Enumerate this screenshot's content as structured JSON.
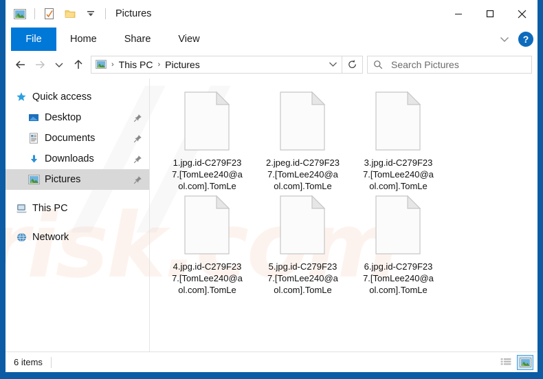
{
  "window": {
    "title": "Pictures",
    "quick_access_toolbar": [
      {
        "name": "pictures-library-icon",
        "label": "Pictures library"
      },
      {
        "name": "properties-icon",
        "label": "Properties"
      },
      {
        "name": "new-folder-icon",
        "label": "New folder"
      },
      {
        "name": "customize-quick-access-icon",
        "label": "Customize Quick Access Toolbar"
      }
    ],
    "caption_buttons": [
      {
        "name": "minimize-button",
        "label": "Minimize",
        "glyph": "—"
      },
      {
        "name": "maximize-button",
        "label": "Maximize",
        "glyph": "□"
      },
      {
        "name": "close-button",
        "label": "Close",
        "glyph": "✕"
      }
    ]
  },
  "ribbon": {
    "tabs": [
      {
        "label": "File",
        "active": true
      },
      {
        "label": "Home",
        "active": false
      },
      {
        "label": "Share",
        "active": false
      },
      {
        "label": "View",
        "active": false
      }
    ],
    "expand_label": "Expand the Ribbon",
    "help_label": "?"
  },
  "address": {
    "back_label": "Back",
    "forward_label": "Forward",
    "recent_label": "Recent locations",
    "up_label": "Up",
    "breadcrumb": [
      "This PC",
      "Pictures"
    ],
    "separator": "›",
    "dropdown_label": "Previous locations",
    "refresh_label": "Refresh"
  },
  "search": {
    "placeholder": "Search Pictures",
    "value": ""
  },
  "sidebar": {
    "items": [
      {
        "label": "Quick access",
        "icon": "star-icon",
        "level": "root",
        "pinned": false,
        "selected": false
      },
      {
        "label": "Desktop",
        "icon": "desktop-icon",
        "level": "child",
        "pinned": true,
        "selected": false
      },
      {
        "label": "Documents",
        "icon": "documents-icon",
        "level": "child",
        "pinned": true,
        "selected": false
      },
      {
        "label": "Downloads",
        "icon": "downloads-icon",
        "level": "child",
        "pinned": true,
        "selected": false
      },
      {
        "label": "Pictures",
        "icon": "pictures-icon",
        "level": "child",
        "pinned": true,
        "selected": true
      },
      {
        "label": "This PC",
        "icon": "this-pc-icon",
        "level": "root",
        "pinned": false,
        "selected": false
      },
      {
        "label": "Network",
        "icon": "network-icon",
        "level": "root",
        "pinned": false,
        "selected": false
      }
    ]
  },
  "files": [
    {
      "name": "1.jpg.id-C279F237.[TomLee240@aol.com].TomLe",
      "icon": "blank-file-icon"
    },
    {
      "name": "2.jpeg.id-C279F237.[TomLee240@aol.com].TomLe",
      "icon": "blank-file-icon"
    },
    {
      "name": "3.jpg.id-C279F237.[TomLee240@aol.com].TomLe",
      "icon": "blank-file-icon"
    },
    {
      "name": "4.jpg.id-C279F237.[TomLee240@aol.com].TomLe",
      "icon": "blank-file-icon"
    },
    {
      "name": "5.jpg.id-C279F237.[TomLee240@aol.com].TomLe",
      "icon": "blank-file-icon"
    },
    {
      "name": "6.jpg.id-C279F237.[TomLee240@aol.com].TomLe",
      "icon": "blank-file-icon"
    }
  ],
  "statusbar": {
    "item_count": "6 items",
    "views": [
      {
        "name": "details-view-button",
        "label": "Details view",
        "active": false
      },
      {
        "name": "large-icons-view-button",
        "label": "Large icons view",
        "active": true
      }
    ]
  },
  "watermark": {
    "text": "risk.com",
    "shape": "//"
  },
  "colors": {
    "window_border": "#0b5ca5",
    "file_tab": "#0078d7",
    "selection": "#d8d8d8",
    "help_blue": "#0d6bbd",
    "view_active_fill": "#cde8f9",
    "view_active_border": "#4a9fd8"
  }
}
